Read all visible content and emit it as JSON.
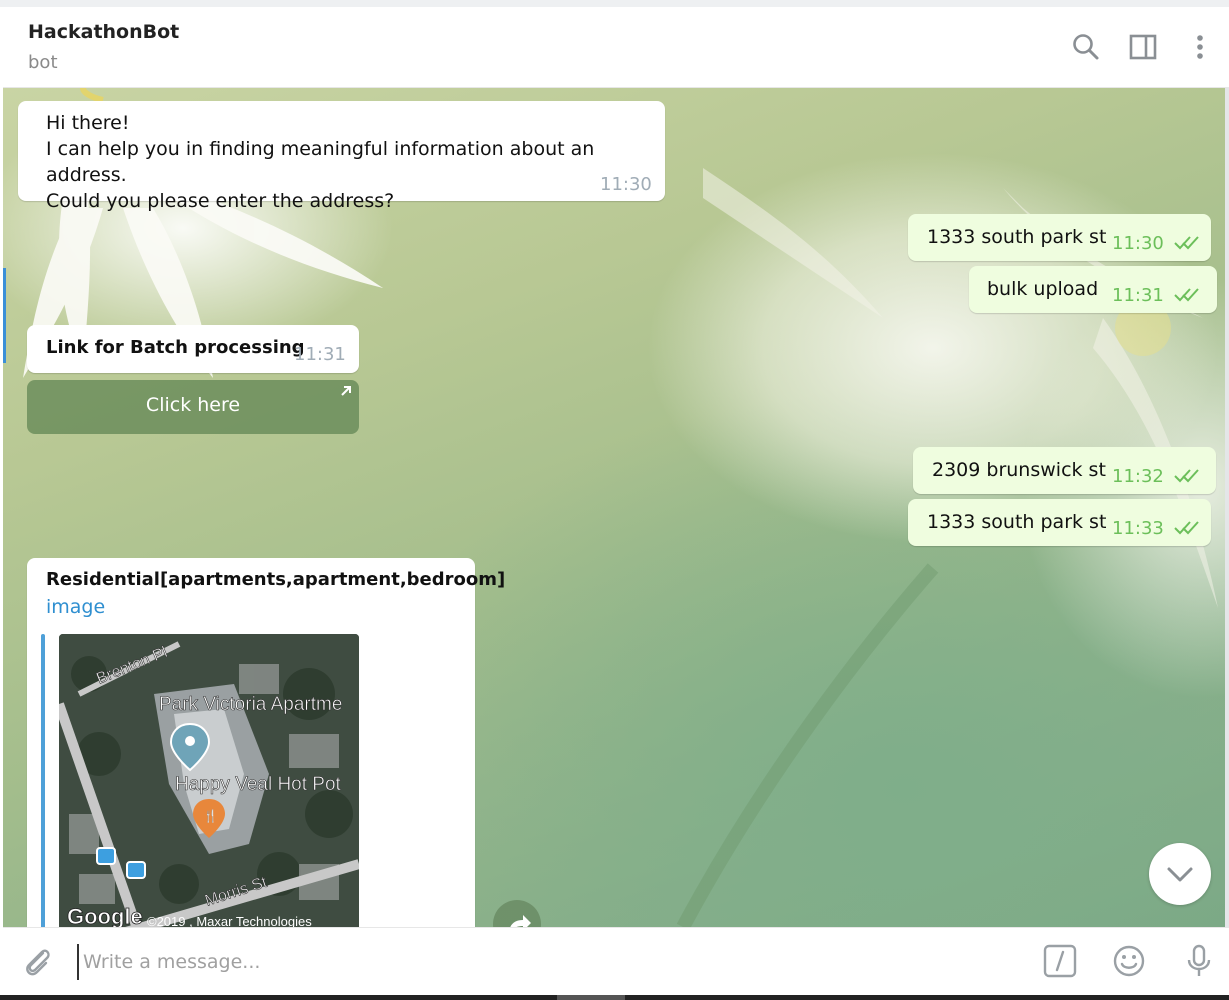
{
  "header": {
    "title": "HackathonBot",
    "subtitle": "bot",
    "icons": [
      "search-icon",
      "sidebar-toggle-icon",
      "more-vertical-icon"
    ]
  },
  "messages": [
    {
      "direction": "in",
      "lines": [
        "Hi there!",
        "I can help you in finding meaningful information about an address.",
        "Could you please enter the address?"
      ],
      "time": "11:30"
    },
    {
      "direction": "out",
      "text": "1333 south park st",
      "time": "11:30",
      "status": "read"
    },
    {
      "direction": "out",
      "text": "bulk upload",
      "time": "11:31",
      "status": "read"
    },
    {
      "direction": "in",
      "text": "Link for Batch processing",
      "time": "11:31",
      "button": "Click here"
    },
    {
      "direction": "out",
      "text": "2309 brunswick st",
      "time": "11:32",
      "status": "read"
    },
    {
      "direction": "out",
      "text": "1333 south park st",
      "time": "11:33",
      "status": "read"
    },
    {
      "direction": "in",
      "title": "Residential[apartments,apartment,bedroom]",
      "link": "image"
    }
  ],
  "map": {
    "labels": [
      "Brenton Pl",
      "Park Victoria Apartme",
      "Happy Veal Hot Pot",
      "Morris St"
    ],
    "logo": "Google",
    "copyright": "©2019 , Maxar Technologies"
  },
  "composer": {
    "placeholder": "Write a message...",
    "icons": [
      "attach-icon",
      "bot-commands-icon",
      "emoji-icon",
      "microphone-icon"
    ]
  },
  "colors": {
    "outgoing_bubble": "#effddf",
    "incoming_bubble": "#ffffff",
    "time_out": "#6cbf5a",
    "link": "#2f8fd0"
  }
}
